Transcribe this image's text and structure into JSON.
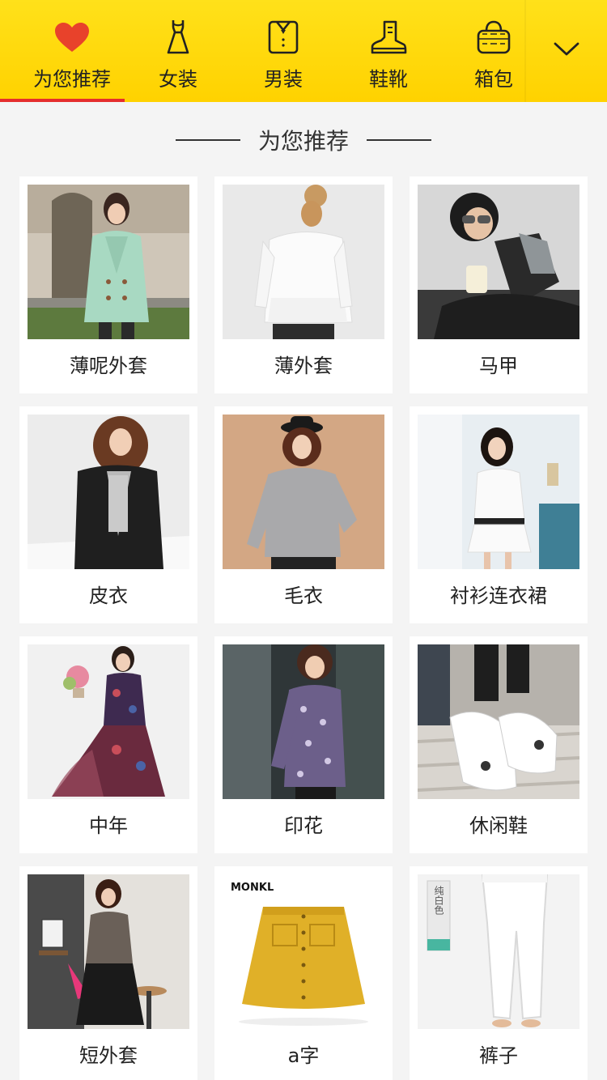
{
  "tabs": [
    {
      "label": "为您推荐",
      "icon": "heart-icon",
      "active": true
    },
    {
      "label": "女装",
      "icon": "dress-icon"
    },
    {
      "label": "男装",
      "icon": "shirt-icon"
    },
    {
      "label": "鞋靴",
      "icon": "boot-icon"
    },
    {
      "label": "箱包",
      "icon": "handbag-icon"
    }
  ],
  "more_icon": "chevron-down-icon",
  "colors": {
    "bar": "#ffd800",
    "accent": "#e52e2e",
    "heart": "#e8422b"
  },
  "section": {
    "title": "为您推荐"
  },
  "items": [
    {
      "name": "薄呢外套"
    },
    {
      "name": "薄外套"
    },
    {
      "name": "马甲"
    },
    {
      "name": "皮衣"
    },
    {
      "name": "毛衣"
    },
    {
      "name": "衬衫连衣裙"
    },
    {
      "name": "中年"
    },
    {
      "name": "印花"
    },
    {
      "name": "休闲鞋"
    },
    {
      "name": "短外套"
    },
    {
      "name": "a字"
    },
    {
      "name": "裤子"
    }
  ],
  "image_text": {
    "brand": "MONKL",
    "tag": "纯白色"
  }
}
